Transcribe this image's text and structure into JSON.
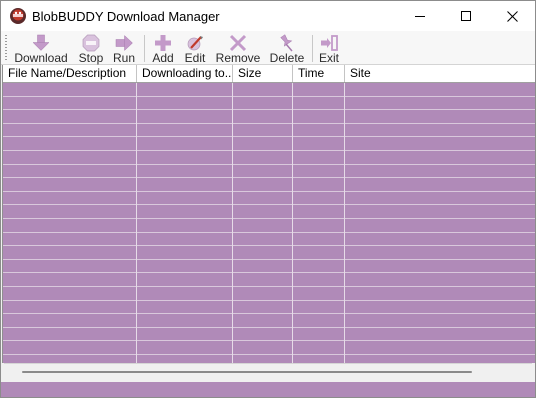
{
  "window": {
    "title": "BlobBUDDY Download Manager",
    "icon": "blobbuddy-app-icon",
    "controls": {
      "minimize_icon": "minimize-icon",
      "maximize_icon": "maximize-icon",
      "close_icon": "close-icon"
    }
  },
  "toolbar": {
    "buttons": [
      {
        "label": "Download",
        "icon": "download-arrow-icon"
      },
      {
        "label": "Stop",
        "icon": "stop-sign-icon"
      },
      {
        "label": "Run",
        "icon": "run-arrow-icon"
      },
      {
        "label": "Add",
        "icon": "plus-icon"
      },
      {
        "label": "Edit",
        "icon": "pencil-icon"
      },
      {
        "label": "Remove",
        "icon": "x-icon"
      },
      {
        "label": "Delete",
        "icon": "pushpin-icon"
      },
      {
        "label": "Exit",
        "icon": "exit-icon"
      }
    ]
  },
  "list": {
    "columns": [
      "File Name/Description",
      "Downloading to...",
      "Size",
      "Time",
      "Site"
    ],
    "rows": [],
    "colors": {
      "background": "#b08ab8",
      "grid": "#e6dbe8"
    }
  },
  "colors": {
    "accent": "#b08ab8",
    "icon": "#c39ac9"
  }
}
